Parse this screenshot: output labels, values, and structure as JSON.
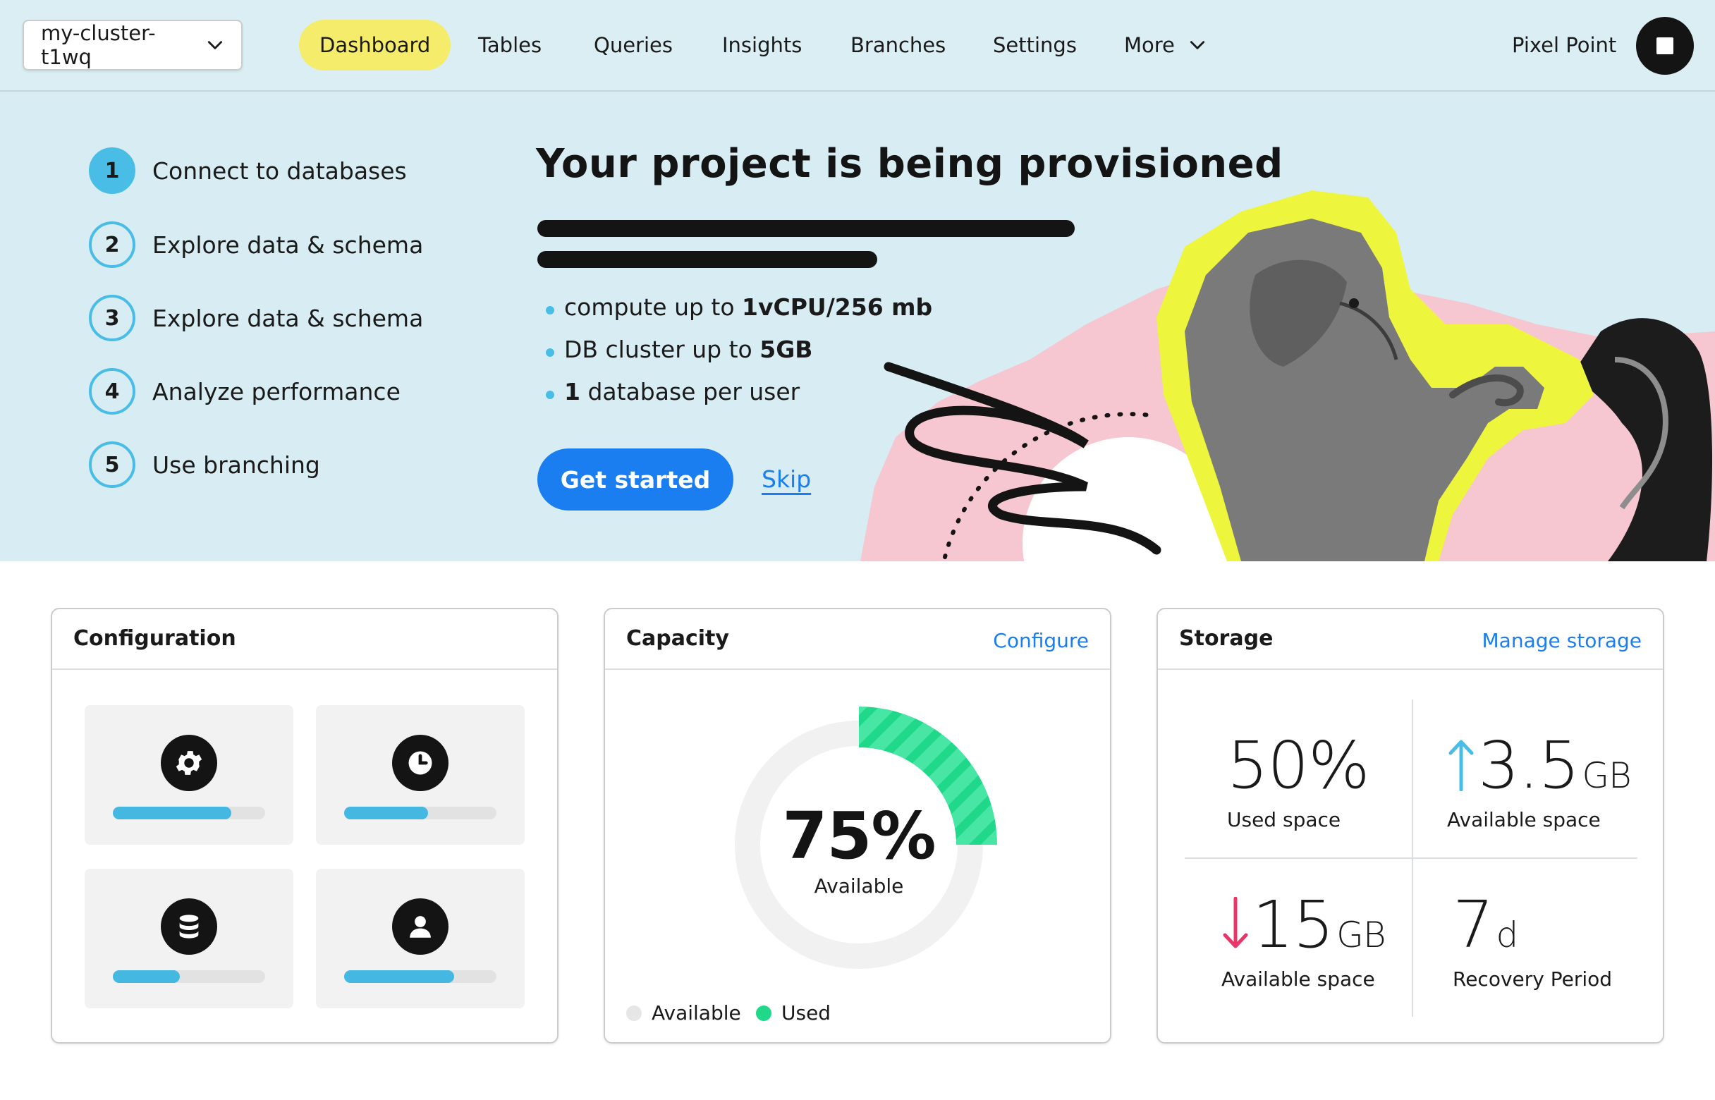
{
  "nav": {
    "cluster": "my-cluster-t1wq",
    "items": [
      {
        "label": "Dashboard",
        "active": true
      },
      {
        "label": "Tables"
      },
      {
        "label": "Queries"
      },
      {
        "label": "Insights"
      },
      {
        "label": "Branches"
      },
      {
        "label": "Settings"
      },
      {
        "label": "More"
      }
    ],
    "user": "Pixel Point"
  },
  "steps": [
    {
      "num": "1",
      "label": "Connect to databases",
      "active": true
    },
    {
      "num": "2",
      "label": "Explore data & schema"
    },
    {
      "num": "3",
      "label": "Explore data & schema"
    },
    {
      "num": "4",
      "label": "Analyze performance"
    },
    {
      "num": "5",
      "label": "Use branching"
    }
  ],
  "hero": {
    "title": "Your project is being provisioned",
    "features": [
      {
        "prefix": "compute up to ",
        "bold": "1vCPU/256 mb",
        "suffix": ""
      },
      {
        "prefix": "DB cluster up to ",
        "bold": "5GB",
        "suffix": ""
      },
      {
        "prefix": "",
        "bold": "1",
        "suffix": " database per user"
      }
    ],
    "cta": "Get started",
    "skip": "Skip"
  },
  "configuration": {
    "title": "Configuration",
    "tiles": [
      {
        "icon": "gear-icon",
        "level": 0.78
      },
      {
        "icon": "clock-icon",
        "level": 0.55
      },
      {
        "icon": "database-icon",
        "level": 0.44
      },
      {
        "icon": "user-icon",
        "level": 0.72
      }
    ]
  },
  "capacity": {
    "title": "Capacity",
    "link": "Configure",
    "value": "75%",
    "value_label": "Available",
    "used_fraction": 0.25,
    "legend": [
      {
        "label": "Available",
        "color": "#e6e6e6"
      },
      {
        "label": "Used",
        "color": "#1fd889"
      }
    ]
  },
  "storage": {
    "title": "Storage",
    "link": "Manage storage",
    "stats": [
      {
        "value": "50%",
        "unit": "",
        "label": "Used space",
        "arrow": ""
      },
      {
        "value": "3.5",
        "unit": "GB",
        "label": "Available space",
        "arrow": "up"
      },
      {
        "value": "15",
        "unit": "GB",
        "label": "Available space",
        "arrow": "down"
      },
      {
        "value": "7",
        "unit": "d",
        "label": "Recovery Period",
        "arrow": ""
      }
    ]
  },
  "colors": {
    "accent": "#1a7ef0",
    "highlight": "#f5ec6c",
    "step": "#49bde6",
    "hero_bg": "#d8edf3",
    "used": "#1fd889",
    "arrow_up": "#49bde6",
    "arrow_down": "#e8366b"
  }
}
